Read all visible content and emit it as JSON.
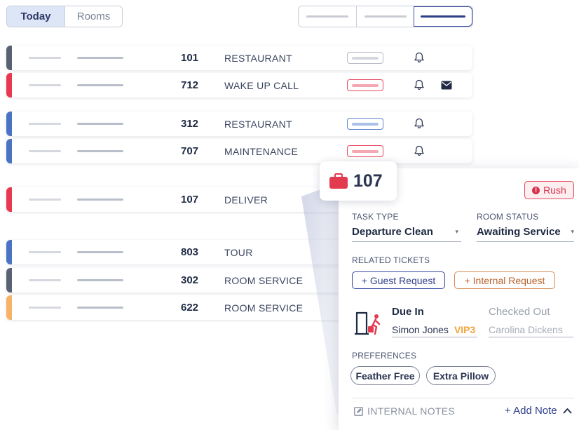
{
  "tabs": {
    "today": "Today",
    "rooms": "Rooms"
  },
  "view_switch": [
    "view-compact",
    "view-medium",
    "view-expanded"
  ],
  "rows": [
    {
      "room": "101",
      "type": "RESTAURANT",
      "accent": "#596273",
      "tag_color": "#b8bcc6",
      "tag_fill": "#d4d7de",
      "mail": false
    },
    {
      "room": "712",
      "type": "WAKE UP CALL",
      "accent": "#e8384f",
      "tag_color": "#e84a62",
      "tag_fill": "#f4a8b4",
      "mail": true
    },
    {
      "room": "312",
      "type": "RESTAURANT",
      "accent": "#4b73c4",
      "tag_color": "#5d84cf",
      "tag_fill": "#a9c0e8",
      "mail": false
    },
    {
      "room": "707",
      "type": "MAINTENANCE",
      "accent": "#4b73c4",
      "tag_color": "#e84a62",
      "tag_fill": "#f4a8b4",
      "mail": false
    },
    {
      "room": "107",
      "type": "DELIVER",
      "accent": "#e8384f"
    },
    {
      "room": "803",
      "type": "TOUR",
      "accent": "#4b73c4"
    },
    {
      "room": "302",
      "type": "ROOM SERVICE",
      "accent": "#596273"
    },
    {
      "room": "622",
      "type": "ROOM SERVICE",
      "accent": "#f6b266"
    }
  ],
  "detail": {
    "room": "107",
    "rush_label": "Rush",
    "task_type_label": "TASK TYPE",
    "task_type_value": "Departure Clean",
    "room_status_label": "ROOM STATUS",
    "room_status_value": "Awaiting Service",
    "related_tickets_label": "RELATED TICKETS",
    "guest_request": "+ Guest Request",
    "internal_request": "+ Internal Request",
    "due_in_label": "Due In",
    "checked_out_label": "Checked Out",
    "guest_name": "Simon Jones",
    "vip": "VIP3",
    "checked_out_guest": "Carolina Dickens",
    "preferences_label": "PREFERENCES",
    "preferences": [
      "Feather Free",
      "Extra Pillow"
    ],
    "internal_notes_label": "INTERNAL NOTES",
    "add_note": "+ Add Note"
  },
  "colors": {
    "accent_blue": "#2f3f8a",
    "rush_red": "#d5334b",
    "vip_orange": "#f2a33d",
    "suitcase_red": "#e23a4f"
  }
}
